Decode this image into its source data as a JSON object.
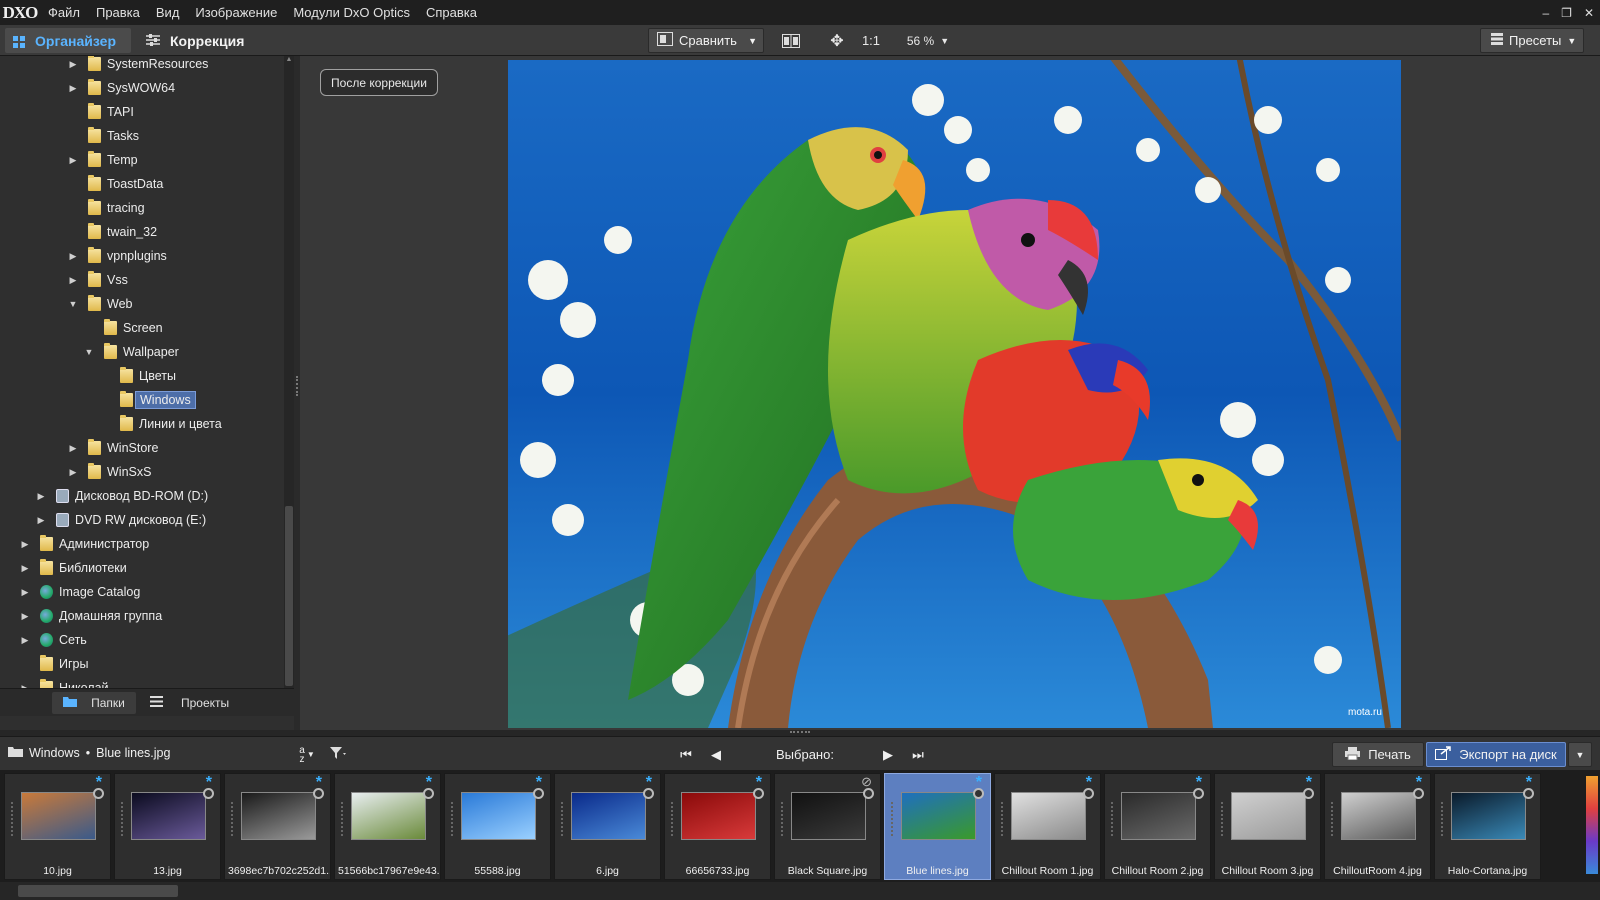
{
  "app": {
    "logo": "DXO"
  },
  "menu": [
    "Файл",
    "Правка",
    "Вид",
    "Изображение",
    "Модули DxO Optics",
    "Справка"
  ],
  "window_controls": {
    "minimize": "‒",
    "restore": "❐",
    "close": "✕"
  },
  "toolbar": {
    "organizer_label": "Органайзер",
    "correction_label": "Коррекция",
    "compare_label": "Сравнить",
    "zoom_1to1": "1:1",
    "zoom_value": "56 %",
    "presets_label": "Пресеты"
  },
  "tree": [
    {
      "label": "SystemResources",
      "icon": "folder",
      "level": 1,
      "arrow": "right"
    },
    {
      "label": "SysWOW64",
      "icon": "folder",
      "level": 1,
      "arrow": "right"
    },
    {
      "label": "TAPI",
      "icon": "folder",
      "level": 1,
      "arrow": ""
    },
    {
      "label": "Tasks",
      "icon": "folder",
      "level": 1,
      "arrow": ""
    },
    {
      "label": "Temp",
      "icon": "folder",
      "level": 1,
      "arrow": "right"
    },
    {
      "label": "ToastData",
      "icon": "folder",
      "level": 1,
      "arrow": ""
    },
    {
      "label": "tracing",
      "icon": "folder",
      "level": 1,
      "arrow": ""
    },
    {
      "label": "twain_32",
      "icon": "folder",
      "level": 1,
      "arrow": ""
    },
    {
      "label": "vpnplugins",
      "icon": "folder",
      "level": 1,
      "arrow": "right"
    },
    {
      "label": "Vss",
      "icon": "folder",
      "level": 1,
      "arrow": "right"
    },
    {
      "label": "Web",
      "icon": "folder",
      "level": 1,
      "arrow": "down"
    },
    {
      "label": "Screen",
      "icon": "folder",
      "level": 2,
      "arrow": ""
    },
    {
      "label": "Wallpaper",
      "icon": "folder",
      "level": 2,
      "arrow": "down"
    },
    {
      "label": "Цветы",
      "icon": "folder",
      "level": 3,
      "arrow": ""
    },
    {
      "label": "Windows",
      "icon": "folder",
      "level": 3,
      "arrow": "",
      "selected": true
    },
    {
      "label": "Линии и цвета",
      "icon": "folder",
      "level": 3,
      "arrow": ""
    },
    {
      "label": "WinStore",
      "icon": "folder",
      "level": 1,
      "arrow": "right"
    },
    {
      "label": "WinSxS",
      "icon": "folder",
      "level": 1,
      "arrow": "right"
    },
    {
      "label": "Дисковод BD-ROM (D:)",
      "icon": "drive",
      "level": 0,
      "arrow": "right"
    },
    {
      "label": "DVD RW дисковод (E:)",
      "icon": "drive",
      "level": 0,
      "arrow": "right"
    },
    {
      "label": "Администратор",
      "icon": "folder",
      "level": -1,
      "arrow": "right"
    },
    {
      "label": "Библиотеки",
      "icon": "folder",
      "level": -1,
      "arrow": "right"
    },
    {
      "label": "Image Catalog",
      "icon": "globe",
      "level": -1,
      "arrow": "right"
    },
    {
      "label": "Домашняя группа",
      "icon": "globe",
      "level": -1,
      "arrow": "right"
    },
    {
      "label": "Сеть",
      "icon": "globe",
      "level": -1,
      "arrow": "right"
    },
    {
      "label": "Игры",
      "icon": "folder",
      "level": -1,
      "arrow": ""
    },
    {
      "label": "Николай",
      "icon": "folder",
      "level": -1,
      "arrow": "right"
    }
  ],
  "panel_tabs": {
    "folders": "Папки",
    "projects": "Проекты"
  },
  "viewer": {
    "badge": "После коррекции",
    "watermark": "mota.ru"
  },
  "filmbar": {
    "path_folder": "Windows",
    "path_sep": "•",
    "path_file": "Blue lines.jpg",
    "selected_label": "Выбрано:",
    "print_label": "Печать",
    "export_label": "Экспорт на диск"
  },
  "thumbnails": [
    {
      "name": "10.jpg",
      "mark": "star",
      "colors": [
        "#c97a3a",
        "#3a5a8a"
      ]
    },
    {
      "name": "13.jpg",
      "mark": "star",
      "colors": [
        "#0b0b1f",
        "#6a5a9a"
      ]
    },
    {
      "name": "3698ec7b702c252d1...",
      "mark": "star",
      "colors": [
        "#1a1a1a",
        "#9a9a9a"
      ]
    },
    {
      "name": "51566bc17967e9e43...",
      "mark": "star",
      "colors": [
        "#e8eef0",
        "#6a8a3a"
      ]
    },
    {
      "name": "55588.jpg",
      "mark": "star",
      "colors": [
        "#2a7ad8",
        "#9ad0ff"
      ]
    },
    {
      "name": "6.jpg",
      "mark": "star",
      "colors": [
        "#0a2a8a",
        "#4a8ad8"
      ]
    },
    {
      "name": "66656733.jpg",
      "mark": "star",
      "colors": [
        "#8a0a0a",
        "#d83a3a"
      ]
    },
    {
      "name": "Black Square.jpg",
      "mark": "none",
      "colors": [
        "#111111",
        "#3a3a3a"
      ]
    },
    {
      "name": "Blue lines.jpg",
      "mark": "star",
      "colors": [
        "#1f6fbf",
        "#3a9a2a"
      ],
      "selected": true
    },
    {
      "name": "Chillout Room 1.jpg",
      "mark": "star",
      "colors": [
        "#e0e0e0",
        "#8a8a8a"
      ]
    },
    {
      "name": "Chillout Room 2.jpg",
      "mark": "star",
      "colors": [
        "#2a2a2a",
        "#6a6a6a"
      ]
    },
    {
      "name": "Chillout Room 3.jpg",
      "mark": "star",
      "colors": [
        "#d0d0d0",
        "#9a9a9a"
      ]
    },
    {
      "name": "ChilloutRoom 4.jpg",
      "mark": "star",
      "colors": [
        "#cfcfcf",
        "#5a5a5a"
      ]
    },
    {
      "name": "Halo-Cortana.jpg",
      "mark": "star",
      "colors": [
        "#0a1a2a",
        "#3a8ab8"
      ]
    }
  ]
}
